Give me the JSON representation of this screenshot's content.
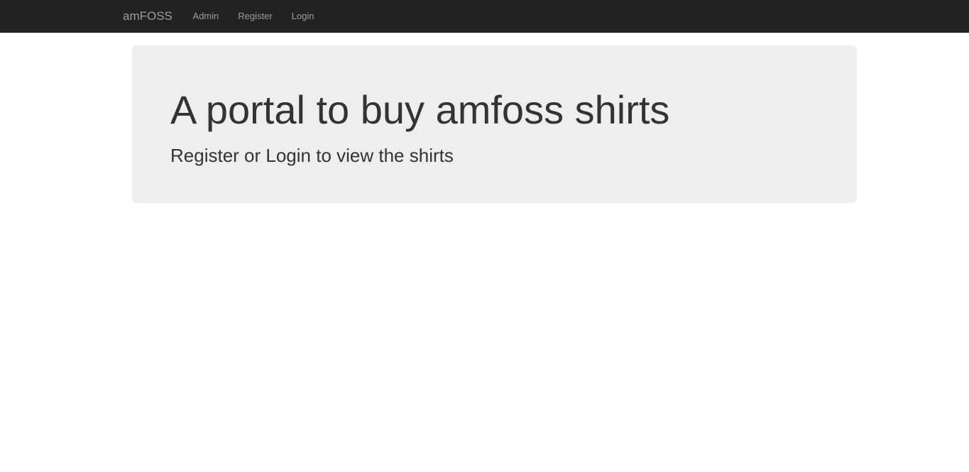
{
  "navbar": {
    "brand": "amFOSS",
    "links": [
      {
        "label": "Admin"
      },
      {
        "label": "Register"
      },
      {
        "label": "Login"
      }
    ]
  },
  "jumbotron": {
    "title": "A portal to buy amfoss shirts",
    "subtitle": "Register or Login to view the shirts"
  },
  "colors": {
    "navbar_bg": "#222222",
    "navbar_text": "#9d9d9d",
    "jumbotron_bg": "#eeeeee",
    "heading_text": "#333333"
  }
}
